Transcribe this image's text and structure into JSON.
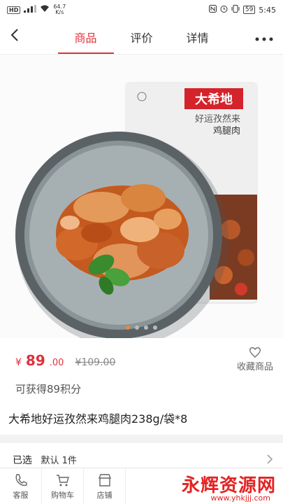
{
  "status": {
    "speed_value": "64.7",
    "speed_unit": "K/s",
    "battery": "59",
    "time": "5:45",
    "hd": "HD"
  },
  "nav": {
    "tabs": [
      {
        "label": "商品"
      },
      {
        "label": "评价"
      },
      {
        "label": "详情"
      }
    ]
  },
  "product": {
    "pkg_brand": "大希地",
    "pkg_line1": "好运孜然来",
    "pkg_line2": "鸡腿肉",
    "currency": "¥",
    "price": "89",
    "cents": ".00",
    "old_price": "¥109.00",
    "favorite_label": "收藏商品",
    "points": "可获得89积分",
    "title": "大希地好运孜然来鸡腿肉238g/袋*8",
    "carousel": {
      "count": 4,
      "active": 1
    }
  },
  "selection": {
    "label": "已选",
    "value": "默认 1件"
  },
  "bottom": {
    "items": [
      {
        "label": "客服"
      },
      {
        "label": "购物车"
      },
      {
        "label": "店铺"
      }
    ]
  },
  "watermark": {
    "text": "永辉资源网",
    "url": "www.yhkjjj.com"
  }
}
